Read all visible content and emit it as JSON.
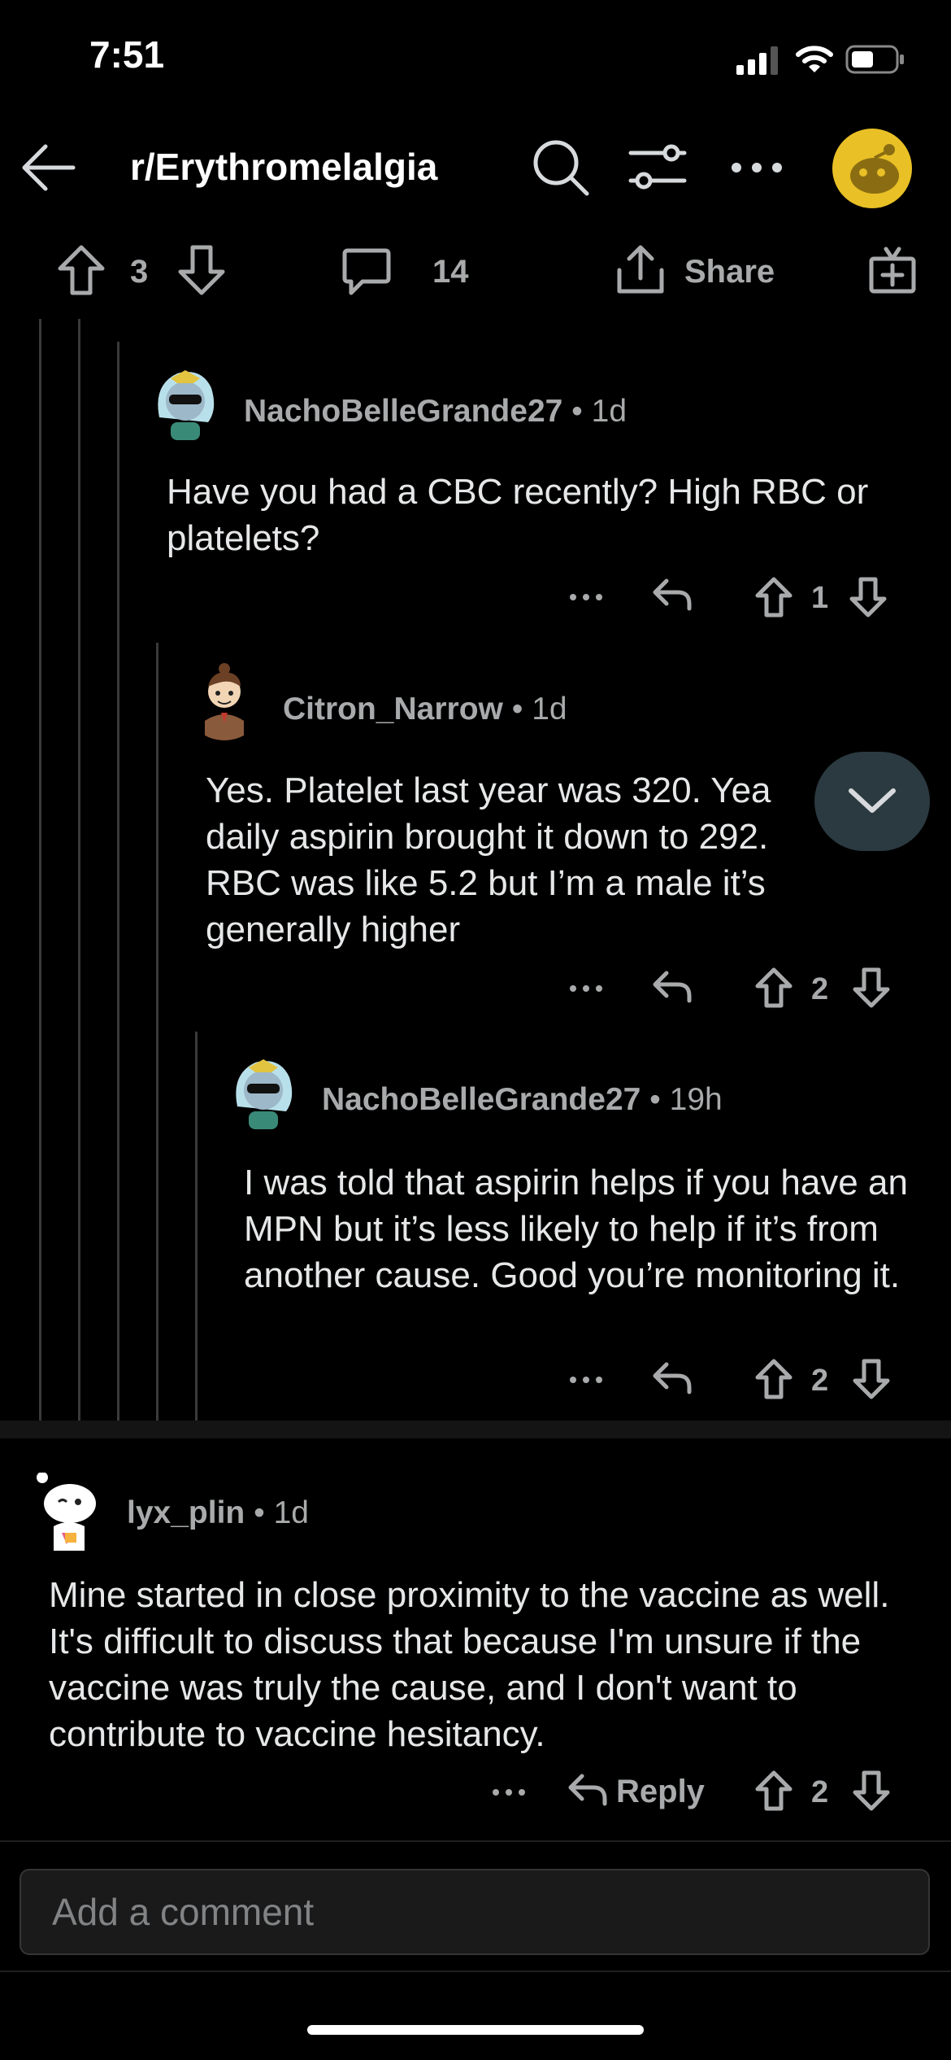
{
  "status_bar": {
    "time": "7:51"
  },
  "header": {
    "subreddit": "r/Erythromelalgia"
  },
  "post_bar": {
    "upvotes": "3",
    "comments": "14",
    "share_label": "Share"
  },
  "comments": [
    {
      "user": "NachoBelleGrande27",
      "age": "• 1d",
      "text": "Have you had a CBC recently? High RBC or platelets?",
      "votes": "1"
    },
    {
      "user": "Citron_Narrow",
      "age": "• 1d",
      "text": "Yes. Platelet last year was 320. Yea daily aspirin brought it down to 292. RBC was like 5.2 but I’m a male it’s generally higher",
      "votes": "2"
    },
    {
      "user": "NachoBelleGrande27",
      "age": "• 19h",
      "text": "I was told that aspirin helps if you have an MPN but it’s less likely to help if it’s from another cause. Good you’re monitoring it.",
      "votes": "2"
    },
    {
      "user": "lyx_plin",
      "age": "• 1d",
      "text": "Mine started in close proximity to the vaccine as well. It's difficult to discuss that because I'm unsure if the vaccine was truly the cause, and I don't want to contribute to vaccine hesitancy.",
      "votes": "2",
      "reply_label": "Reply"
    }
  ],
  "composer": {
    "placeholder": "Add a comment"
  },
  "colors": {
    "background": "#000000",
    "text": "#d7dadc",
    "muted": "#a8aaab",
    "avatar_yellow": "#e9c026"
  }
}
